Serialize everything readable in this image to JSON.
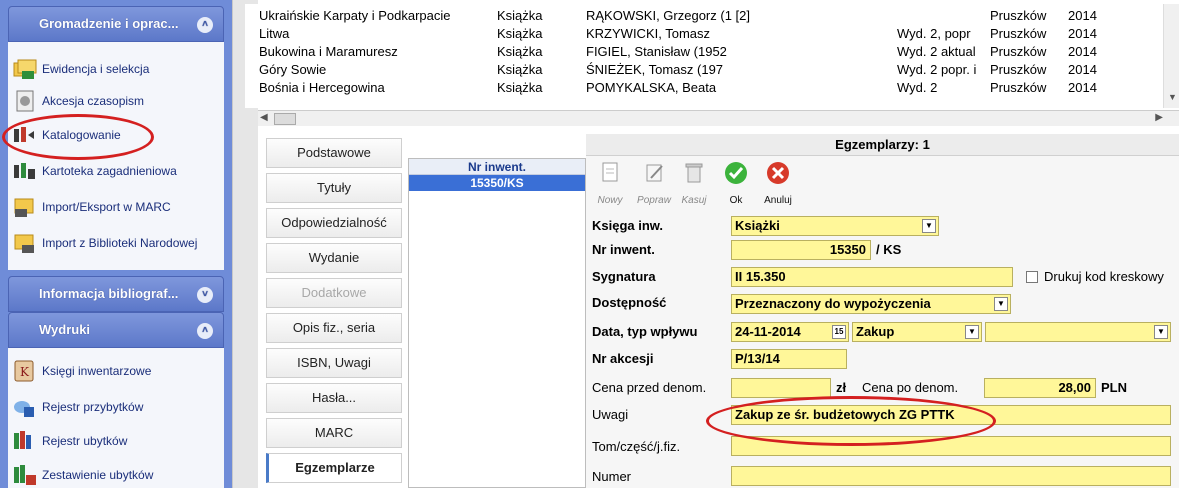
{
  "sidebar": {
    "sections": [
      {
        "title": "Gromadzenie i oprac...",
        "chevron": "»"
      },
      {
        "title": "Informacja bibliograf...",
        "chevron": "»"
      },
      {
        "title": "Wydruki",
        "chevron": "»"
      }
    ],
    "items": [
      {
        "label": "Ewidencja i selekcja",
        "icon": "folders-icon"
      },
      {
        "label": "Akcesja czasopism",
        "icon": "document-icon"
      },
      {
        "label": "Katalogowanie",
        "icon": "catalog-icon"
      },
      {
        "label": "Kartoteka zagadnieniowa",
        "icon": "index-cards-icon"
      },
      {
        "label": "Import/Eksport w MARC",
        "icon": "marc-icon"
      },
      {
        "label": "Import z Biblioteki Narodowej",
        "icon": "bn-icon"
      },
      {
        "label": "Księgi inwentarzowe",
        "icon": "inventory-book-icon"
      },
      {
        "label": "Rejestr przybytków",
        "icon": "register-add-icon"
      },
      {
        "label": "Rejestr ubytków",
        "icon": "register-remove-icon"
      },
      {
        "label": "Zestawienie ubytków",
        "icon": "summary-icon"
      }
    ]
  },
  "table": {
    "rows": [
      [
        "Ukraińskie Karpaty i Podkarpacie",
        "Książka",
        "RĄKOWSKI, Grzegorz (1 [2]",
        "",
        "Pruszków",
        "2014"
      ],
      [
        "Litwa",
        "Książka",
        "KRZYWICKI, Tomasz",
        "Wyd. 2, popr",
        "Pruszków",
        "2014"
      ],
      [
        "Bukowina i Maramuresz",
        "Książka",
        "FIGIEL, Stanisław (1952",
        "Wyd. 2 aktual",
        "Pruszków",
        "2014"
      ],
      [
        "Góry Sowie",
        "Książka",
        "ŚNIEŻEK, Tomasz (197",
        "Wyd. 2 popr. i",
        "Pruszków",
        "2014"
      ],
      [
        "Bośnia i Hercegowina",
        "Książka",
        "POMYKALSKA, Beata",
        "Wyd. 2",
        "Pruszków",
        "2014"
      ]
    ]
  },
  "tabs": [
    "Podstawowe",
    "Tytuły",
    "Odpowiedzialność",
    "Wydanie",
    "Dodatkowe",
    "Opis fiz., seria",
    "ISBN, Uwagi",
    "Hasła...",
    "MARC",
    "Egzemplarze"
  ],
  "inventory_list": {
    "header": "Nr inwent.",
    "selected": "15350/KS"
  },
  "form": {
    "title": "Egzemplarzy: 1",
    "toolbar": {
      "new": "Nowy",
      "edit": "Popraw",
      "delete": "Kasuj",
      "ok": "Ok",
      "cancel": "Anuluj"
    },
    "labels": {
      "ksiega": "Księga inw.",
      "nr_inwent": "Nr inwent.",
      "sygnatura": "Sygnatura",
      "dostepnosc": "Dostępność",
      "data_typ": "Data, typ wpływu",
      "nr_akcesji": "Nr akcesji",
      "cena_przed": "Cena przed denom.",
      "cena_po": "Cena po denom.",
      "uwagi": "Uwagi",
      "tom": "Tom/część/j.fiz.",
      "numer": "Numer",
      "drukuj": "Drukuj kod kreskowy"
    },
    "values": {
      "ksiega": "Książki",
      "nr_inwent": "15350",
      "nr_suffix": "/ KS",
      "sygnatura": "II 15.350",
      "dostepnosc": "Przeznaczony do wypożyczenia",
      "data": "24-11-2014",
      "calendar": "15",
      "typ": "Zakup",
      "typ2": "",
      "nr_akcesji": "P/13/14",
      "cena_przed": "",
      "cena_przed_unit": "zł",
      "cena_po": "28,00",
      "cena_po_unit": "PLN",
      "uwagi": "Zakup ze śr. budżetowych ZG PTTK",
      "tom": "",
      "numer": ""
    }
  },
  "colors": {
    "sidebar": "#6f8cd8",
    "field": "#fff799",
    "highlight": "#d42020",
    "selection": "#3a6fd6"
  }
}
